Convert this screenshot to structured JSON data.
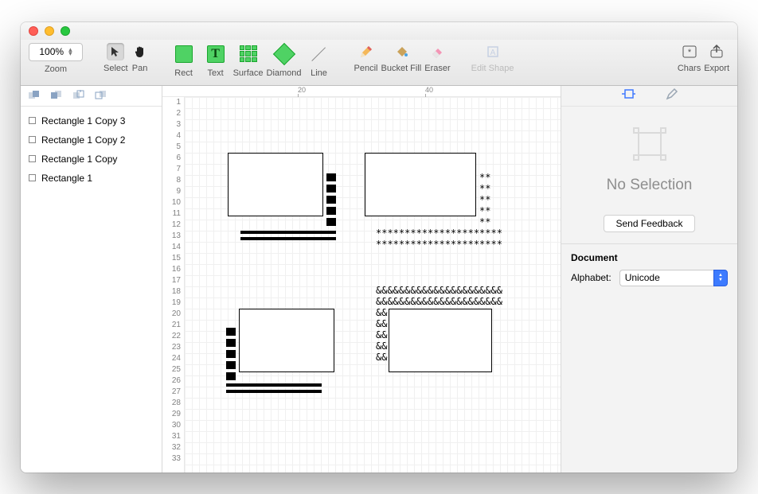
{
  "zoom": {
    "value": "100%",
    "label": "Zoom"
  },
  "tools": {
    "select": "Select",
    "pan": "Pan",
    "rect": "Rect",
    "text": "Text",
    "surface": "Surface",
    "diamond": "Diamond",
    "line": "Line",
    "pencil": "Pencil",
    "bucket": "Bucket Fill",
    "eraser": "Eraser",
    "editshape": "Edit Shape",
    "chars": "Chars",
    "export": "Export",
    "text_T": "T"
  },
  "ruler": {
    "t20": "20",
    "t40": "40"
  },
  "gutter_rows": [
    "1",
    "2",
    "3",
    "4",
    "5",
    "6",
    "7",
    "8",
    "9",
    "10",
    "11",
    "12",
    "13",
    "14",
    "15",
    "16",
    "17",
    "18",
    "19",
    "20",
    "21",
    "22",
    "23",
    "24",
    "25",
    "26",
    "27",
    "28",
    "29",
    "30",
    "31",
    "32",
    "33"
  ],
  "layers": {
    "items": [
      {
        "label": "Rectangle 1 Copy 3"
      },
      {
        "label": "Rectangle 1 Copy 2"
      },
      {
        "label": "Rectangle 1 Copy"
      },
      {
        "label": "Rectangle 1"
      }
    ]
  },
  "canvas": {
    "topright_stars": "**\n**\n**\n**\n**",
    "topright_stars_rows": "**********************\n**********************",
    "bl_amp_top": "&&&&&&&&&&&&&&&&&&&&&&\n&&&&&&&&&&&&&&&&&&&&&&",
    "bl_amp_side": "&&\n&&\n&&\n&&\n&&"
  },
  "inspector": {
    "no_selection": "No Selection",
    "feedback": "Send Feedback",
    "doc_heading": "Document",
    "alphabet_label": "Alphabet:",
    "alphabet_value": "Unicode"
  }
}
